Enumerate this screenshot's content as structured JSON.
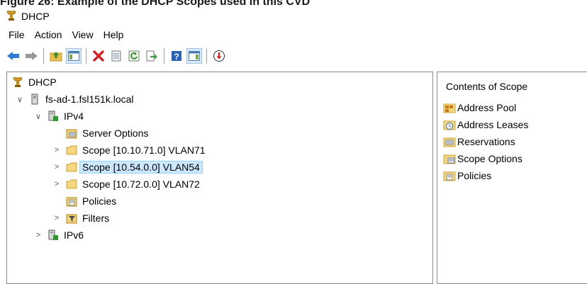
{
  "caption": "Figure 26:  Example of the DHCP Scopes used in this CVD",
  "window": {
    "title": "DHCP"
  },
  "menu": [
    "File",
    "Action",
    "View",
    "Help"
  ],
  "toolbar": {
    "buttons": [
      "back-arrow-icon",
      "forward-arrow-icon",
      "up-folder-icon",
      "show-hide-tree-icon",
      "delete-icon",
      "properties-icon",
      "refresh-icon",
      "export-list-icon",
      "help-icon",
      "action-pane-icon",
      "down-arrow-icon"
    ]
  },
  "tree": {
    "root": "DHCP",
    "server": "fs-ad-1.fsl151k.local",
    "ipv4": "IPv4",
    "server_options": "Server Options",
    "scope1": "Scope [10.10.71.0] VLAN71",
    "scope2": "Scope [10.54.0.0] VLAN54",
    "scope3": "Scope [10.72.0.0] VLAN72",
    "policies": "Policies",
    "filters": "Filters",
    "ipv6": "IPv6",
    "selected": "Scope [10.54.0.0] VLAN54"
  },
  "contents": {
    "title": "Contents of Scope",
    "items": [
      "Address Pool",
      "Address Leases",
      "Reservations",
      "Scope Options",
      "Policies"
    ]
  }
}
